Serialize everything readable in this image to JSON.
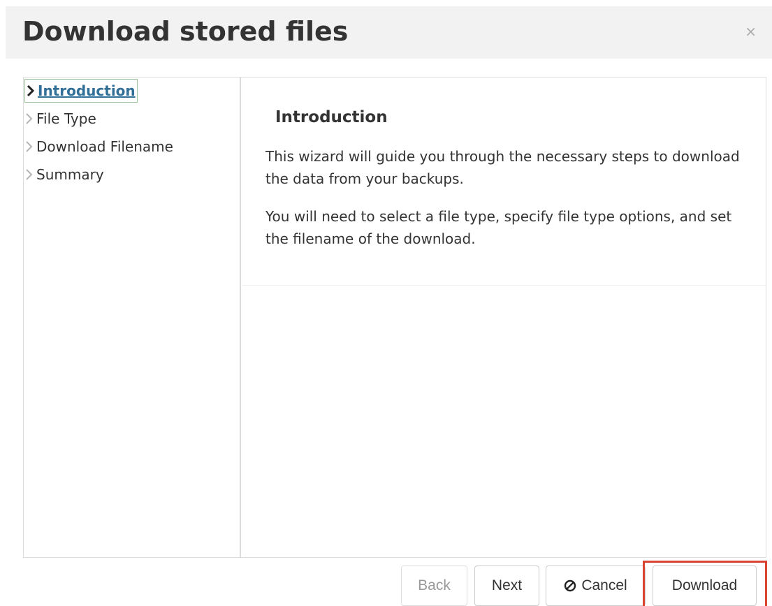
{
  "dialog": {
    "title": "Download stored files",
    "close_label": "×"
  },
  "steps": [
    {
      "label": "Introduction",
      "active": true
    },
    {
      "label": "File Type",
      "active": false
    },
    {
      "label": "Download Filename",
      "active": false
    },
    {
      "label": "Summary",
      "active": false
    }
  ],
  "content": {
    "title": "Introduction",
    "paragraphs": [
      "This wizard will guide you through the necessary steps to download the data from your backups.",
      "You will need to select a file type, specify file type options, and set the filename of the download."
    ]
  },
  "buttons": {
    "back": "Back",
    "next": "Next",
    "cancel": "Cancel",
    "download": "Download"
  },
  "icons": {
    "step_active": "chevron-right-icon",
    "step_inactive": "chevron-right-icon",
    "cancel": "ban-icon",
    "close": "close-icon"
  },
  "colors": {
    "active_step_text": "#2f6f98",
    "highlight_border": "#d9432f",
    "titlebar_bg": "#f2f2f2"
  }
}
